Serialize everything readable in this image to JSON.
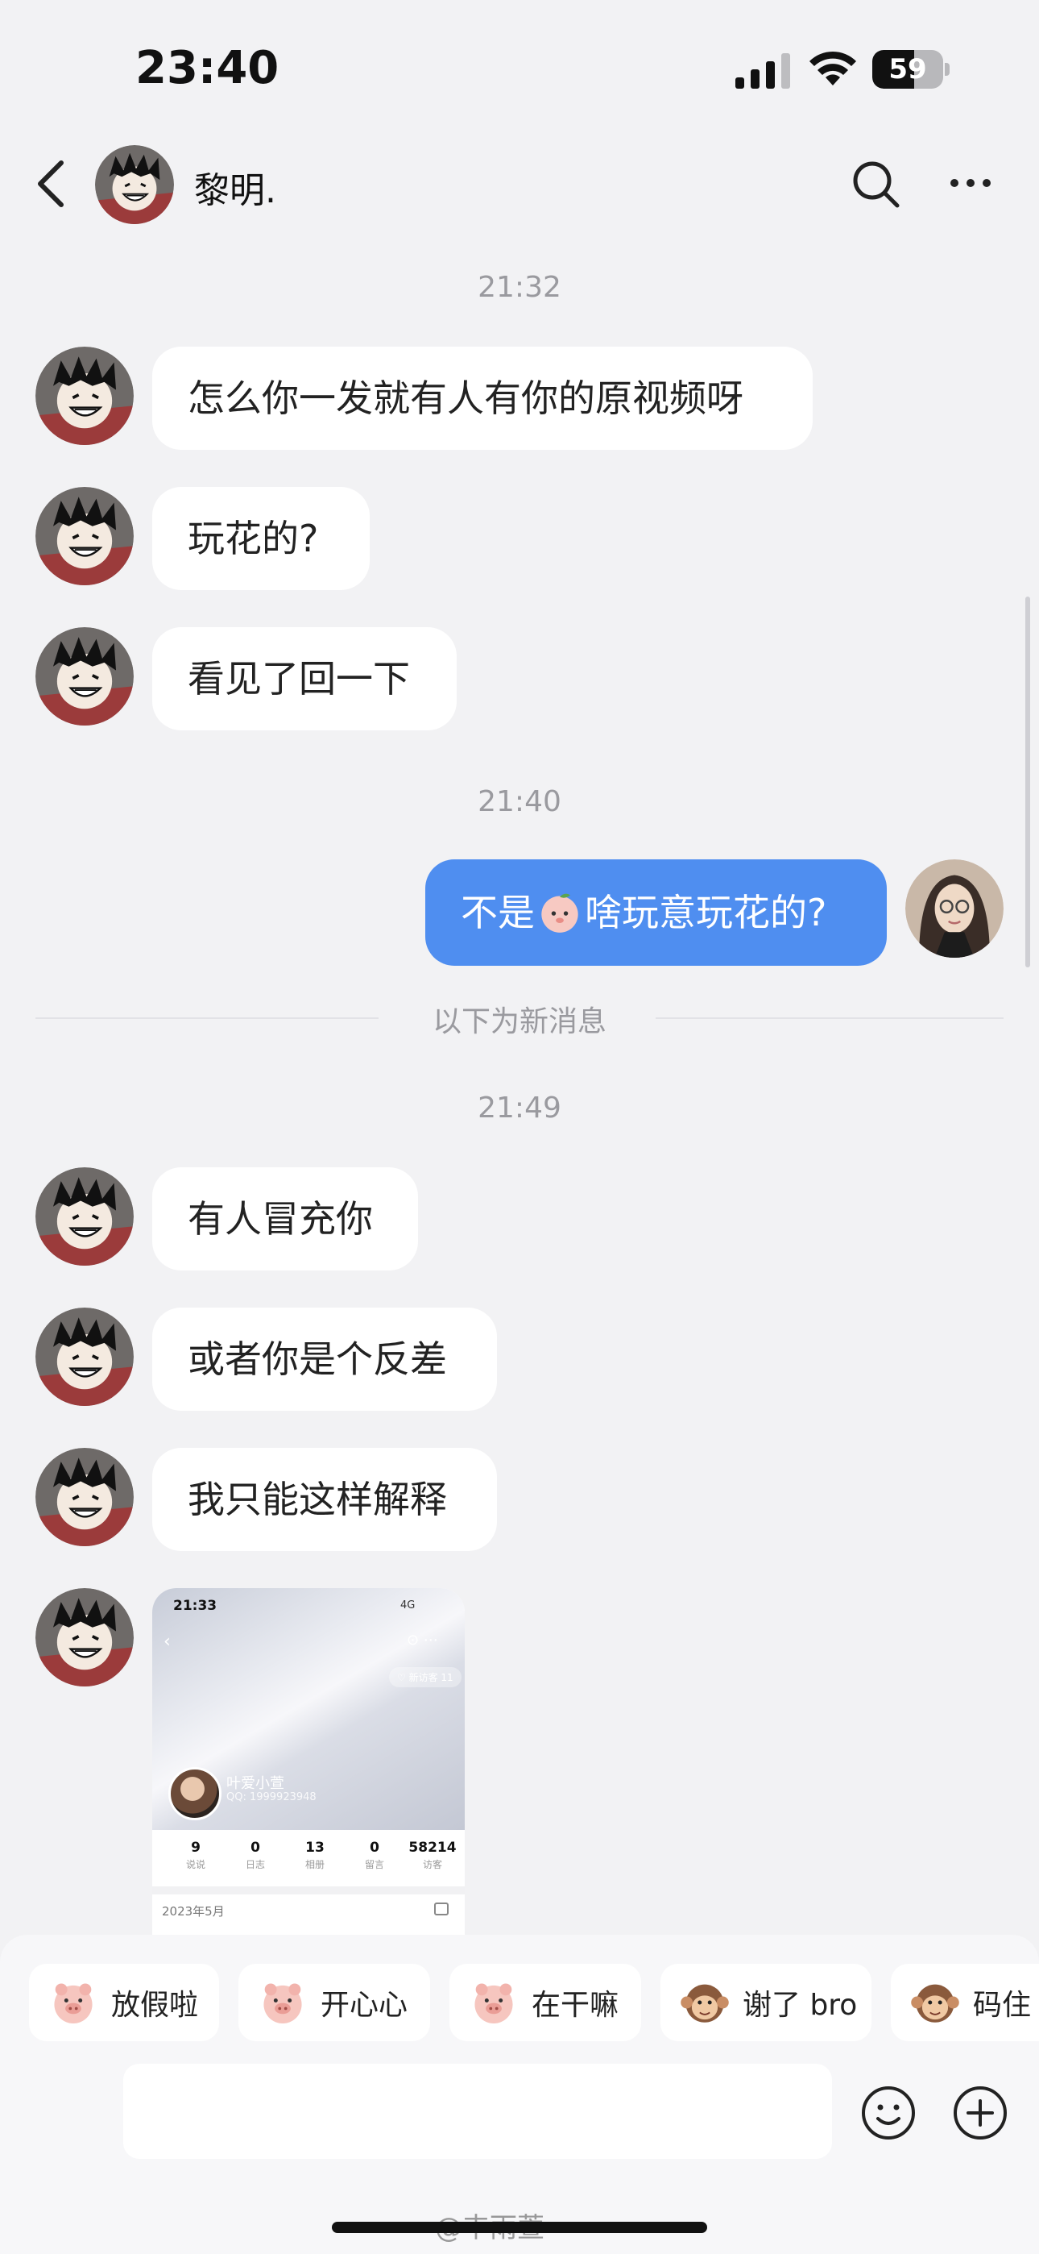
{
  "status_bar": {
    "time": "23:40",
    "battery_level": "59",
    "battery_fraction": 0.59,
    "icons": [
      "signal-icon",
      "wifi-icon",
      "battery-icon"
    ]
  },
  "nav": {
    "contact_name": "黎明.",
    "back_icon": "chevron-left-icon",
    "search_icon": "search-icon",
    "more_icon": "more-icon"
  },
  "timestamps": [
    "21:32",
    "21:40",
    "21:49"
  ],
  "new_message_divider": "以下为新消息",
  "messages": [
    {
      "from": "contact",
      "text": "怎么你一发就有人有你的原视频呀"
    },
    {
      "from": "contact",
      "text": "玩花的?"
    },
    {
      "from": "contact",
      "text": "看见了回一下"
    },
    {
      "from": "me",
      "text_before": "不是",
      "emoji": "peach-face-emoji",
      "text_after": "啥玩意玩花的?"
    },
    {
      "from": "contact",
      "text": "有人冒充你"
    },
    {
      "from": "contact",
      "text": "或者你是个反差"
    },
    {
      "from": "contact",
      "text": "我只能这样解释"
    }
  ],
  "image_message": {
    "time": "21:33",
    "status": "4G",
    "visitor_badge": "♡ 新访客 11",
    "profile_name": "叶爱小萱",
    "profile_qq": "QQ: 1999923948",
    "stats": [
      {
        "num": "9",
        "label": "说说"
      },
      {
        "num": "0",
        "label": "日志"
      },
      {
        "num": "13",
        "label": "相册"
      },
      {
        "num": "0",
        "label": "留言"
      },
      {
        "num": "58214",
        "label": "访客"
      }
    ],
    "date": "2023年5月"
  },
  "sticker_suggestions": [
    {
      "label": "放假啦",
      "icon": "pig-sticker-icon"
    },
    {
      "label": "开心心",
      "icon": "pig-sticker-icon"
    },
    {
      "label": "在干嘛",
      "icon": "pig-sticker-icon"
    },
    {
      "label": "谢了 bro",
      "icon": "monkey-sticker-icon"
    },
    {
      "label": "码住",
      "icon": "monkey-sticker-icon"
    }
  ],
  "input": {
    "emoji_icon": "smiley-icon",
    "plus_icon": "plus-circle-icon"
  },
  "watermark": "@丰雨萱",
  "colors": {
    "background": "#f2f2f4",
    "my_bubble": "#4f8ef0",
    "their_bubble": "#ffffff",
    "timestamp": "#9a9a9f"
  }
}
